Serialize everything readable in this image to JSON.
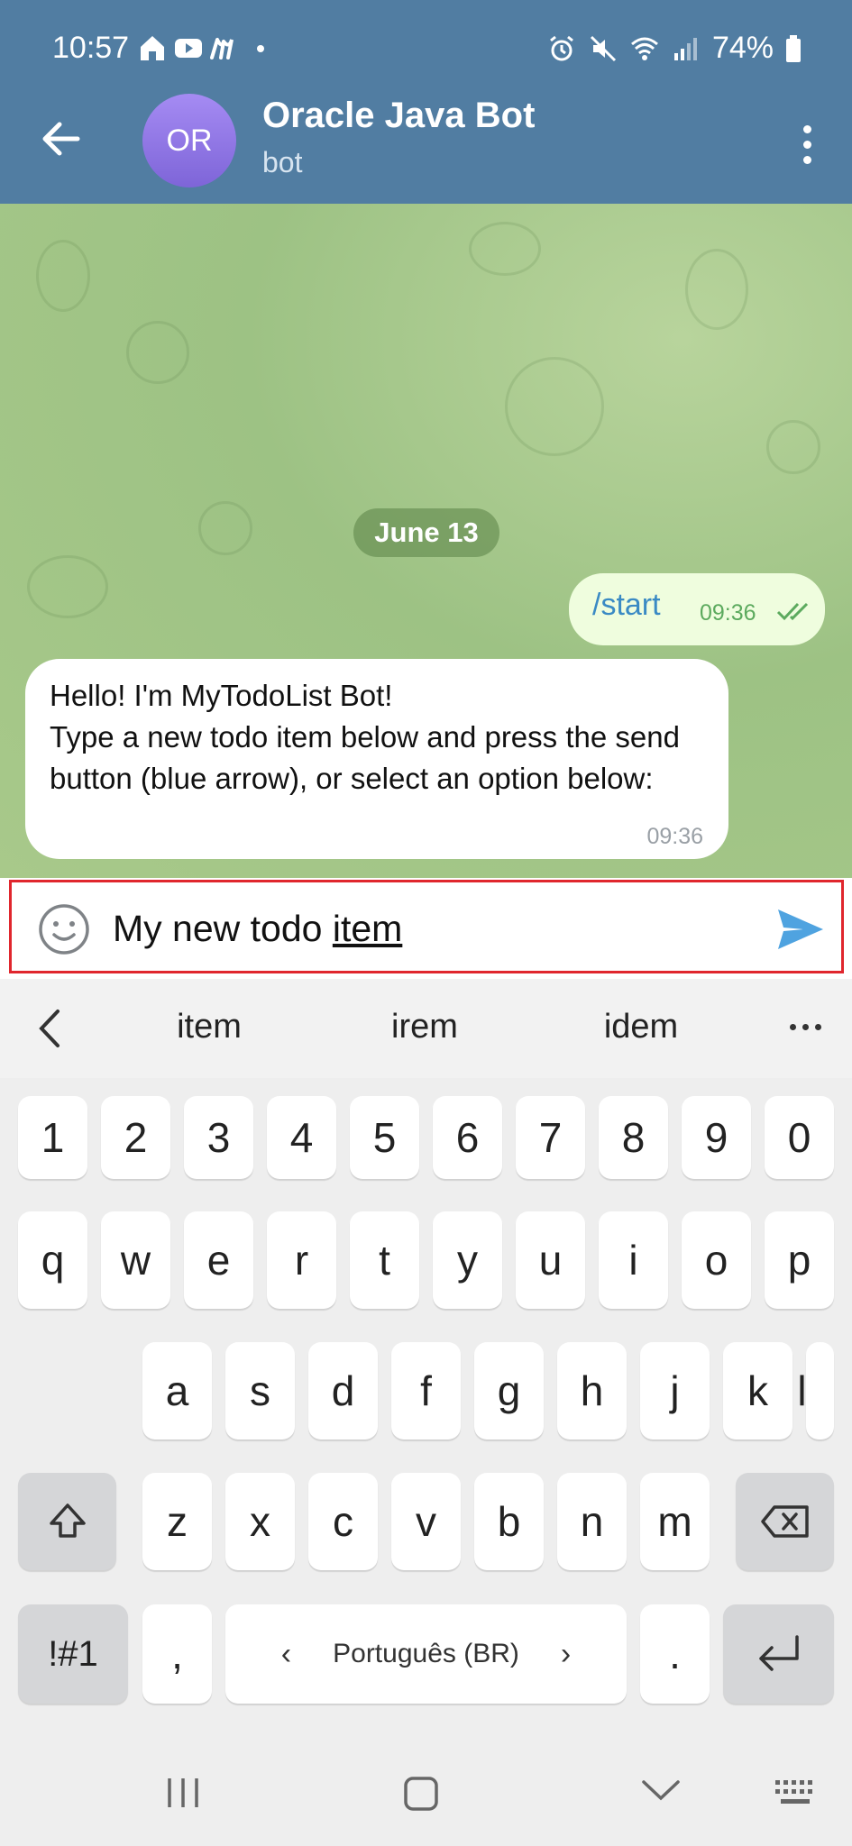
{
  "status": {
    "time": "10:57",
    "battery": "74%"
  },
  "header": {
    "avatar_initials": "OR",
    "title": "Oracle Java Bot",
    "subtitle": "bot"
  },
  "chat": {
    "date_chip": "June 13",
    "outgoing": {
      "text": "/start",
      "time": "09:36"
    },
    "incoming": {
      "text": "Hello! I'm MyTodoList Bot!\nType a new todo item below and press the send button (blue arrow), or select an option below:",
      "time": "09:36"
    }
  },
  "input": {
    "text_prefix": "My new todo ",
    "text_underlined": "item"
  },
  "suggestions": [
    "item",
    "irem",
    "idem"
  ],
  "keyboard": {
    "numbers": [
      "1",
      "2",
      "3",
      "4",
      "5",
      "6",
      "7",
      "8",
      "9",
      "0"
    ],
    "row1": [
      "q",
      "w",
      "e",
      "r",
      "t",
      "y",
      "u",
      "i",
      "o",
      "p"
    ],
    "row2": [
      "a",
      "s",
      "d",
      "f",
      "g",
      "h",
      "j",
      "k",
      "l"
    ],
    "row3": [
      "z",
      "x",
      "c",
      "v",
      "b",
      "n",
      "m"
    ],
    "symbols_key": "!#1",
    "comma_key": ",",
    "period_key": ".",
    "space_label": "Português (BR)"
  },
  "colors": {
    "header": "#517da2",
    "outgoing_bubble": "#effdde",
    "highlight_border": "#e0262d",
    "send_arrow": "#4fa3e0"
  }
}
